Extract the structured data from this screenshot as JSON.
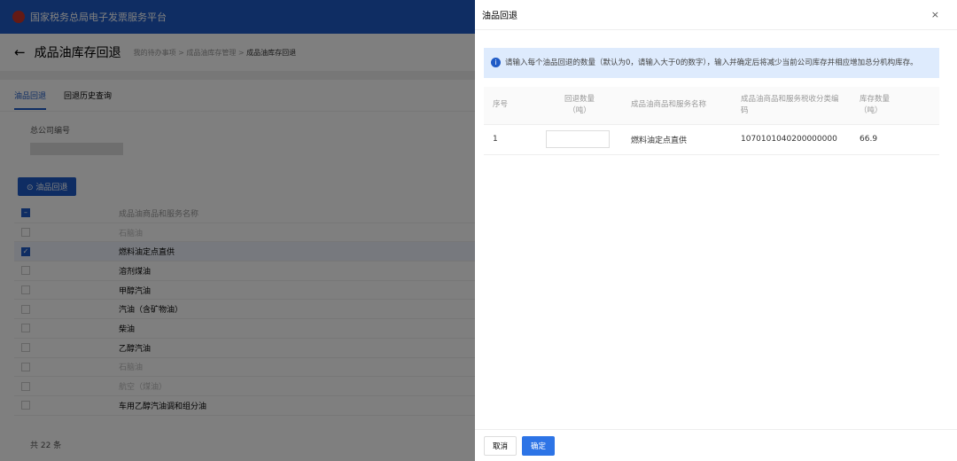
{
  "header": {
    "platform_title": "国家税务总局电子发票服务平台"
  },
  "page": {
    "title": "成品油库存回退",
    "breadcrumb": [
      "我的待办事项",
      "成品油库存管理",
      "成品油库存回退"
    ]
  },
  "tabs": [
    "油品回退",
    "回退历史查询"
  ],
  "form": {
    "label": "总公司编号"
  },
  "action_button": "油品回退",
  "list": {
    "header": "成品油商品和服务名称",
    "rows": [
      {
        "name": "石脑油",
        "checked": false,
        "disabled": true
      },
      {
        "name": "燃料油定点直供",
        "checked": true,
        "disabled": false
      },
      {
        "name": "溶剂煤油",
        "checked": false,
        "disabled": false
      },
      {
        "name": "甲醇汽油",
        "checked": false,
        "disabled": false
      },
      {
        "name": "汽油（含矿物油）",
        "checked": false,
        "disabled": false
      },
      {
        "name": "柴油",
        "checked": false,
        "disabled": false
      },
      {
        "name": "乙醇汽油",
        "checked": false,
        "disabled": false
      },
      {
        "name": "石脑油",
        "checked": false,
        "disabled": true
      },
      {
        "name": "航空（煤油）",
        "checked": false,
        "disabled": true
      },
      {
        "name": "车用乙醇汽油调和组分油",
        "checked": false,
        "disabled": false
      }
    ]
  },
  "total": "共 22 条",
  "drawer": {
    "title": "油品回退",
    "close": "×",
    "notice": "请输入每个油品回退的数量（默认为0，请输入大于0的数字），输入并确定后将减少当前公司库存并相应增加总分机构库存。",
    "columns": [
      "序号",
      "回退数量\n（吨）",
      "成品油商品和服务名称",
      "成品油商品和服务税收分类编码",
      "库存数量\n（吨）"
    ],
    "rows": [
      {
        "index": "1",
        "qty": "",
        "name": "燃料油定点直供",
        "code": "1070101040200000000",
        "stock": "66.9"
      }
    ],
    "cancel": "取消",
    "confirm": "确定"
  }
}
